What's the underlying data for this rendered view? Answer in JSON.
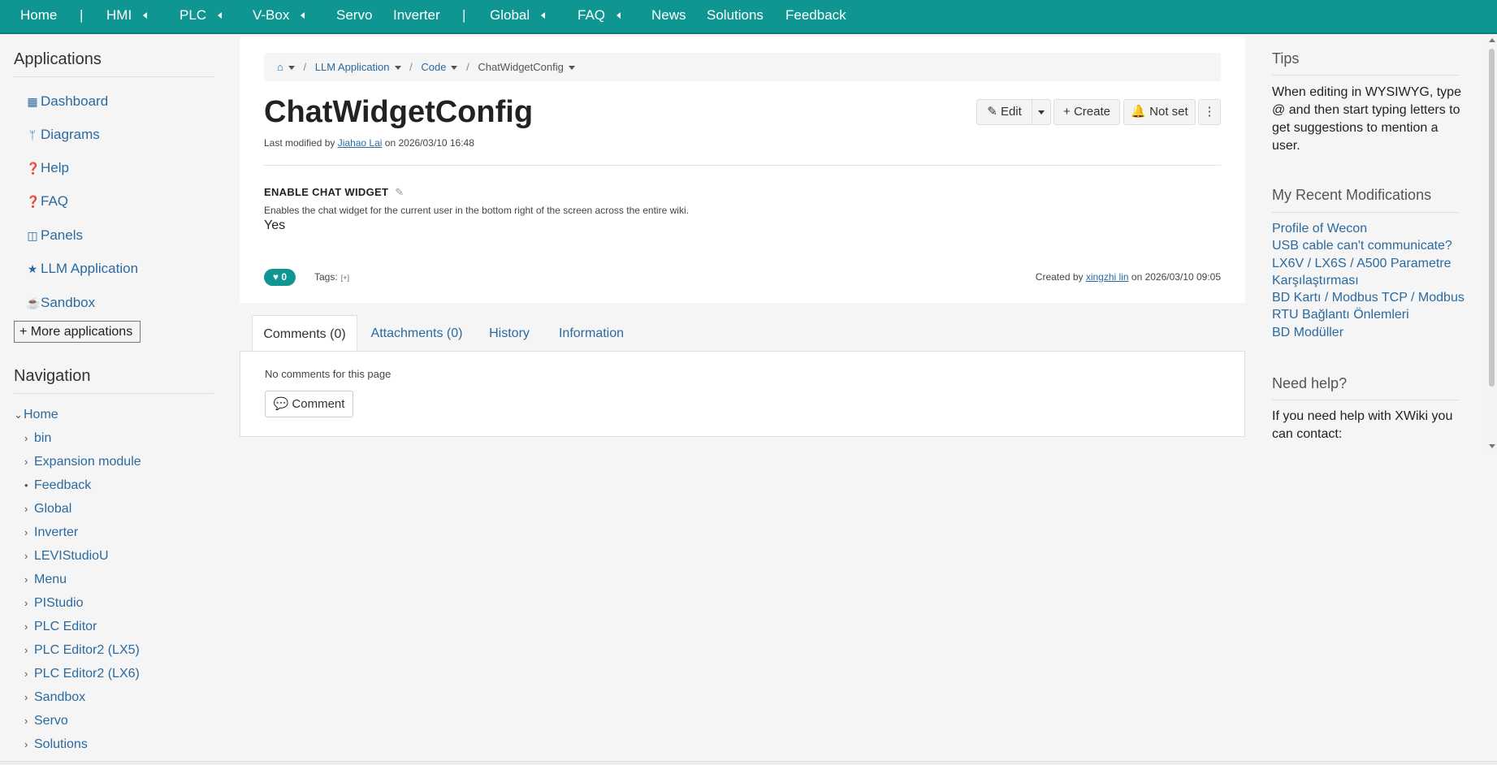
{
  "topnav": {
    "home": "Home",
    "sep1": "|",
    "hmi": "HMI",
    "plc": "PLC",
    "vbox": "V-Box",
    "servo": "Servo",
    "inverter": "Inverter",
    "sep2": "|",
    "global": "Global",
    "faq": "FAQ",
    "news": "News",
    "solutions": "Solutions",
    "feedback": "Feedback"
  },
  "applications": {
    "title": "Applications",
    "items": [
      {
        "label": "Dashboard",
        "icon": "dashboard-icon",
        "glyph": "▦"
      },
      {
        "label": "Diagrams",
        "icon": "branch-icon",
        "glyph": "ᛘ"
      },
      {
        "label": "Help",
        "icon": "question-icon",
        "glyph": "❓"
      },
      {
        "label": "FAQ",
        "icon": "question-icon",
        "glyph": "❓"
      },
      {
        "label": "Panels",
        "icon": "columns-icon",
        "glyph": "◫"
      },
      {
        "label": "LLM Application",
        "icon": "star-icon",
        "glyph": "★"
      },
      {
        "label": "Sandbox",
        "icon": "coffee-icon",
        "glyph": "☕"
      }
    ],
    "more_label": "More applications"
  },
  "navigation": {
    "title": "Navigation",
    "root": "Home",
    "items": [
      "bin",
      "Expansion module",
      "Feedback",
      "Global",
      "Inverter",
      "LEVIStudioU",
      "Menu",
      "PIStudio",
      "PLC Editor",
      "PLC Editor2 (LX5)",
      "PLC Editor2 (LX6)",
      "Sandbox",
      "Servo",
      "Solutions"
    ]
  },
  "breadcrumb": {
    "items": [
      "LLM Application",
      "Code"
    ],
    "current": "ChatWidgetConfig",
    "sep": "/"
  },
  "page": {
    "title": "ChatWidgetConfig",
    "modified_prefix": "Last modified by",
    "modified_author": "Jiahao Lai",
    "modified_on": "on 2026/03/10 16:48"
  },
  "actions": {
    "edit": "Edit",
    "create": "Create",
    "watch": "Not set"
  },
  "property": {
    "label": "ENABLE CHAT WIDGET",
    "description": "Enables the chat widget for the current user in the bottom right of the screen across the entire wiki.",
    "value": "Yes"
  },
  "footer_info": {
    "likes": "0",
    "tags_label": "Tags:",
    "tags_add": "[+]",
    "created_prefix": "Created by",
    "created_author": "xingzhi lin",
    "created_on": "on 2026/03/10 09:05"
  },
  "tabs": {
    "comments": "Comments (0)",
    "attachments": "Attachments (0)",
    "history": "History",
    "information": "Information"
  },
  "comments": {
    "empty_text": "No comments for this page",
    "button": "Comment"
  },
  "right": {
    "tips_title": "Tips",
    "tips_text": "When editing in WYSIWYG, type @ and then start typing letters to get suggestions to mention a user.",
    "recent_title": "My Recent Modifications",
    "recent": [
      "Profile of Wecon",
      "USB cable can't communicate?",
      "LX6V / LX6S / A500 Parametre Karşılaştırması",
      "BD Kartı / Modbus TCP / Modbus RTU Bağlantı Önlemleri",
      "BD Modüller"
    ],
    "help_title": "Need help?",
    "help_text": "If you need help with XWiki you can contact:"
  },
  "colors": {
    "topbar": "#0f9693",
    "link": "#2a6aa0"
  }
}
